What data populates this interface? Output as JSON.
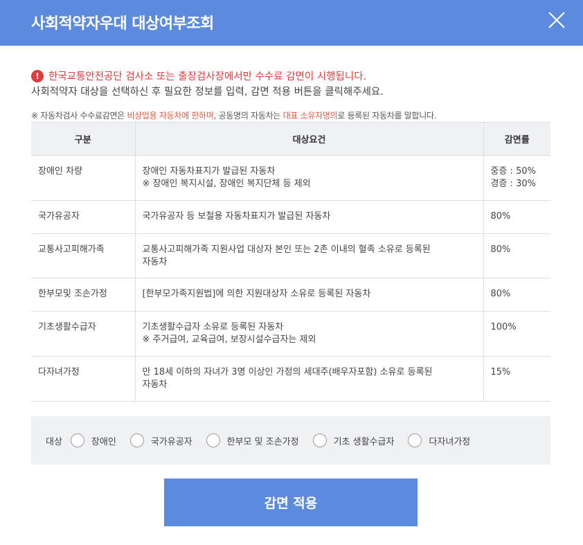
{
  "header": {
    "title": "사회적약자우대 대상여부조회",
    "close_icon": "close-icon"
  },
  "notice": {
    "icon": "exclamation-circle-icon",
    "text": "한국교통안전공단 검사소 또는 출장검사장에서만 수수료 감면이 시행됩니다."
  },
  "subtext": "사회적약자 대상을 선택하신 후 필요한 정보를 입력, 감면 적용 버튼을 클릭해주세요.",
  "note": {
    "part1": "※ 자동차검사 수수료감면은 ",
    "hl1": "비상업용 자동차에 한하며",
    "part2": ", 공동명의 자동차는 ",
    "hl2": "대표 소유자명의",
    "part3": "로 등록된 자동차를 말합니다."
  },
  "table": {
    "headers": [
      "구분",
      "대상요건",
      "감면률"
    ],
    "rows": [
      {
        "category": "장애인 차량",
        "requirement": "장애인 자동차표지가 발급된 자동차\n※ 장애인 복지시설, 장애인 복지단체 등 제외",
        "rate": "중증 : 50%\n경증 : 30%"
      },
      {
        "category": "국가유공자",
        "requirement": "국가유공자 등 보철용 자동차표지가 발급된 자동차",
        "rate": "80%"
      },
      {
        "category": "교통사고피해가족",
        "requirement": "교통사고피해가족 지원사업 대상자 본인 또는 2촌 이내의 혈족 소유로 등록된\n자동차",
        "rate": "80%"
      },
      {
        "category": "한부모및 조손가정",
        "requirement": "[한부모가족지원법]에 의한 지원대상자 소유로 등록된 자동차",
        "rate": "80%"
      },
      {
        "category": "기초생활수급자",
        "requirement": "기초생활수급자 소유로 등록된 자동차\n※ 주거급여, 교육급여, 보장시설수급자는 제외",
        "rate": "100%"
      },
      {
        "category": "다자녀가정",
        "requirement": "만 18세 이하의 자녀가 3명 이상인 가정의 세대주(배우자포함) 소유로 등록된\n자동차",
        "rate": "15%"
      }
    ]
  },
  "filter": {
    "label": "대상",
    "options": [
      "장애인",
      "국가유공자",
      "한부모 및 조손가정",
      "기초 생활수급자",
      "다자녀가정"
    ]
  },
  "apply_button": {
    "label": "감면 적용"
  },
  "colors": {
    "primary": "#5b8ade",
    "alert": "#e03a3a",
    "highlight": "#e8593c",
    "table_header_bg": "#f0f1f5"
  }
}
